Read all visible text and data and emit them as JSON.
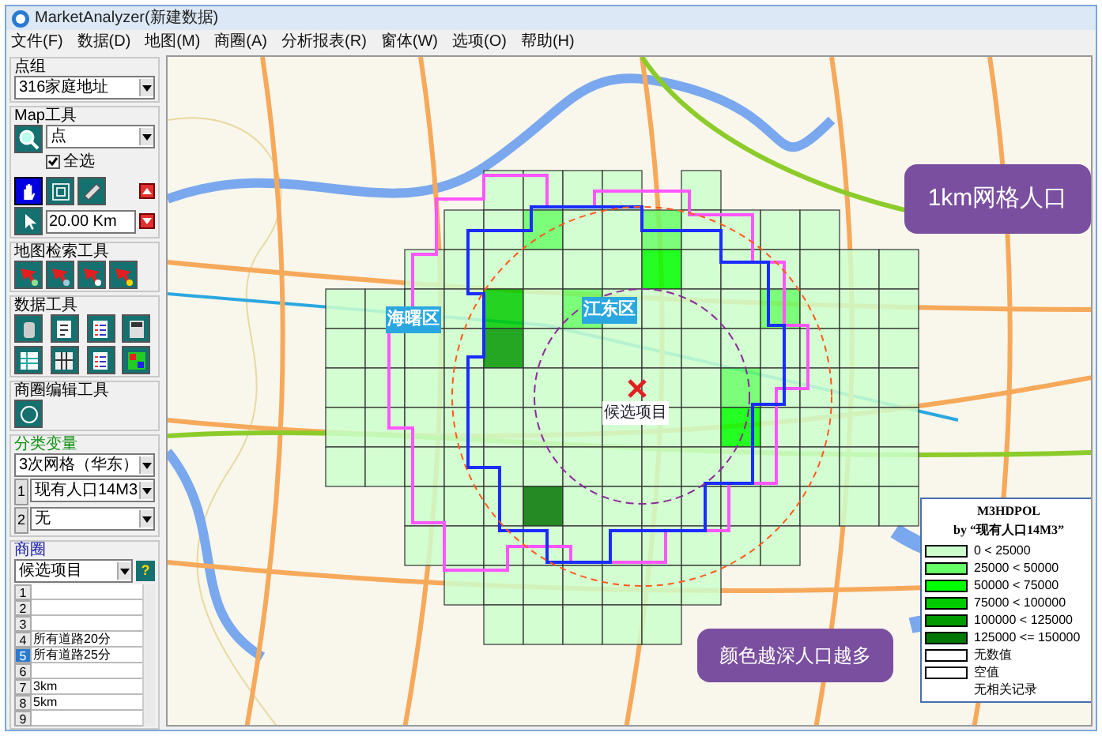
{
  "window": {
    "title": "MarketAnalyzer(新建数据)"
  },
  "menu": [
    "文件(F)",
    "数据(D)",
    "地图(M)",
    "商圈(A)",
    "分析报表(R)",
    "窗体(W)",
    "选项(O)",
    "帮助(H)"
  ],
  "sidebar": {
    "point_group": {
      "label": "点组",
      "value": "316家庭地址"
    },
    "map_tools": {
      "label": "Map工具",
      "point_type": "点",
      "select_all": {
        "label": "全选",
        "checked": true
      },
      "distance": "20.00 Km",
      "tools": [
        {
          "kind": "hand",
          "selected": true
        },
        {
          "kind": "frame",
          "selected": false
        },
        {
          "kind": "ruler",
          "selected": false
        },
        {
          "kind": "pointer",
          "selected": false
        }
      ]
    },
    "search_tools": {
      "label": "地图检索工具"
    },
    "data_tools": {
      "label": "数据工具"
    },
    "edit_tools": {
      "label": "商圈编辑工具"
    },
    "variables": {
      "label": "分类变量",
      "grid": "3次网格（华东）",
      "rows": [
        {
          "index": "1",
          "value": "现有人口14M3"
        },
        {
          "index": "2",
          "value": "无"
        }
      ]
    },
    "trade_area": {
      "label": "商圈",
      "project": "候选项目",
      "help": "?",
      "rows": [
        {
          "index": "1",
          "selected": false
        },
        {
          "index": "2",
          "selected": false
        },
        {
          "index": "3",
          "selected": false
        },
        {
          "index": "4",
          "value": "所有道路20分",
          "selected": false
        },
        {
          "index": "5",
          "value": "所有道路25分",
          "selected": true
        },
        {
          "index": "6",
          "selected": false
        },
        {
          "index": "7",
          "value": "3km",
          "selected": false
        },
        {
          "index": "8",
          "value": "5km",
          "selected": false
        },
        {
          "index": "9",
          "selected": false
        }
      ]
    }
  },
  "map": {
    "districts": [
      "海曙区",
      "江东区"
    ],
    "marker": "候选项目",
    "callouts": [
      "1km网格人口",
      "颜色越深人口越多"
    ],
    "legend": {
      "title": "M3HDPOL",
      "subtitle": "by “现有人口14M3”",
      "items": [
        {
          "kind": "swatch",
          "color": "#ccffcc",
          "label": "0 < 25000"
        },
        {
          "kind": "swatch",
          "color": "#66ff66",
          "label": "25000 < 50000"
        },
        {
          "kind": "swatch",
          "color": "#00ff00",
          "label": "50000 < 75000"
        },
        {
          "kind": "swatch",
          "color": "#00cc00",
          "label": "75000 < 100000"
        },
        {
          "kind": "swatch",
          "color": "#009900",
          "label": "100000 < 125000"
        },
        {
          "kind": "swatch",
          "color": "#007700",
          "label": "125000 <= 150000"
        },
        {
          "kind": "swatch",
          "color": "#ffffff",
          "label": "无数值"
        },
        {
          "kind": "swatch",
          "color": "#ffffff",
          "label": "空值"
        },
        {
          "kind": "text",
          "label": "无相关记录"
        }
      ]
    }
  }
}
